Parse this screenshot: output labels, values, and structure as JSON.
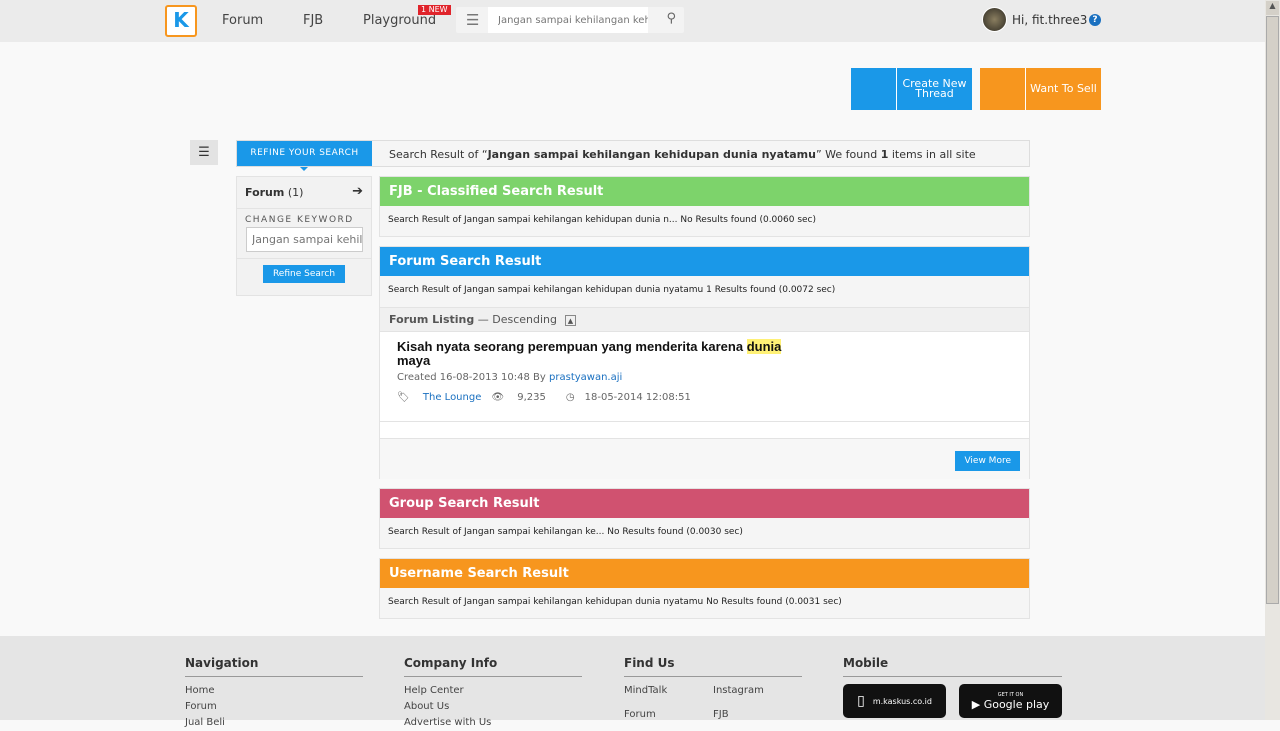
{
  "header": {
    "logo": "K",
    "nav": [
      "Forum",
      "FJB",
      "Playground"
    ],
    "new_badge": "1 NEW",
    "search_value": "Jangan sampai kehilangan kehidupan dunia nyatamu",
    "user_greeting": "Hi, fit.three3"
  },
  "actions": {
    "create_thread": "Create New Thread",
    "want_to_sell": "Want To Sell"
  },
  "refine": {
    "tab": "REFINE YOUR SEARCH",
    "summary_prefix": "Search Result of “",
    "keyword": "Jangan sampai kehilangan kehidupan dunia nyatamu",
    "summary_mid": "” We found ",
    "count": "1",
    "summary_suffix": " items in all site",
    "forum_label": "Forum",
    "forum_count": "(1)",
    "change_keyword": "CHANGE KEYWORD",
    "keyword_placeholder": "Jangan sampai kehilangan kehidupan dunia nyatamu",
    "refine_button": "Refine Search"
  },
  "sections": {
    "fjb": {
      "title": "FJB - Classified Search Result",
      "body": "Search Result of Jangan sampai kehilangan kehidupan dunia n...  No Results found (0.0060 sec)",
      "color": "#7dd36b"
    },
    "forum": {
      "title": "Forum Search Result",
      "body": "Search Result of Jangan sampai kehilangan kehidupan dunia nyatamu 1 Results found (0.0072 sec)",
      "color": "#1a98e8"
    },
    "group": {
      "title": "Group Search Result",
      "body": "Search Result of Jangan sampai kehilangan ke... No Results found (0.0030 sec)",
      "color": "#d05270"
    },
    "username": {
      "title": "Username Search Result",
      "body": "Search Result of Jangan sampai kehilangan kehidupan dunia nyatamu No Results found (0.0031 sec)",
      "color": "#f7961e"
    }
  },
  "listing": {
    "label": "Forum Listing",
    "order": "— Descending",
    "view_more": "View More",
    "item": {
      "title_pre": "Kisah nyata seorang perempuan yang menderita karena ",
      "title_hl": "dunia",
      "title_post": " maya",
      "created": "Created 16-08-2013 10:48 By ",
      "author": "prastyawan.aji",
      "category": "The Lounge",
      "views": "9,235",
      "last": "18-05-2014 12:08:51"
    }
  },
  "footer": {
    "navigation": {
      "title": "Navigation",
      "links": [
        "Home",
        "Forum",
        "Jual Beli"
      ]
    },
    "company": {
      "title": "Company Info",
      "links": [
        "Help Center",
        "About Us",
        "Advertise with Us"
      ]
    },
    "findus": {
      "title": "Find Us",
      "links": [
        "MindTalk",
        "Instagram",
        "Forum",
        "FJB"
      ]
    },
    "mobile": {
      "title": "Mobile",
      "site": "m.kaskus.co.id",
      "play_top": "GET IT ON",
      "play": "Google play"
    }
  }
}
